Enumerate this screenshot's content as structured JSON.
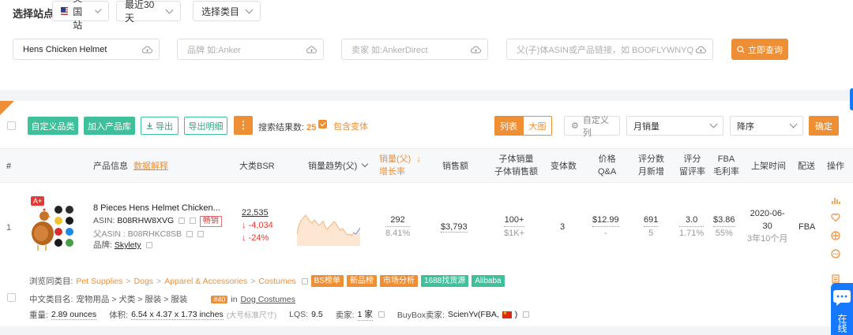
{
  "filters": {
    "site_label": "选择站点",
    "site": "美国站",
    "period": "最近30天",
    "category": "选择类目",
    "keyword_value": "Hens Chicken Helmet",
    "brand_placeholder": "品牌 如:Anker",
    "seller_placeholder": "卖家 如:AnkerDirect",
    "asin_placeholder": "父(子)体ASIN或产品链接，如 BOOFLYWNYQ",
    "query_button": "立即查询"
  },
  "toolbar": {
    "custom_category": "自定义品类",
    "add_library": "加入产品库",
    "export": "导出",
    "export_detail": "导出明细",
    "result_label": "搜索结果数:",
    "result_count": "25",
    "include_variants": "包含变体",
    "view_list": "列表",
    "view_grid": "大图",
    "custom_columns": "自定义列",
    "sort_field": "月销量",
    "sort_order": "降序",
    "confirm": "确定"
  },
  "columns": {
    "index": "#",
    "product_info": "产品信息",
    "data_explain": "数据解释",
    "bsr": "大类BSR",
    "trend": "销量趋势(父)",
    "sales_line1": "销量(父)",
    "sales_line2": "增长率",
    "revenue": "销售额",
    "child_sales_line1": "子体销量",
    "child_sales_line2": "子体销售额",
    "variants": "变体数",
    "price_line1": "价格",
    "price_line2": "Q&A",
    "reviews_line1": "评分数",
    "reviews_line2": "月新增",
    "rating_line1": "评分",
    "rating_line2": "留评率",
    "fba_line1": "FBA",
    "fba_line2": "毛利率",
    "listed": "上架时间",
    "delivery": "配送",
    "actions": "操作"
  },
  "product": {
    "index": "1",
    "badge": "A+",
    "title": "8 Pieces Hens Helmet Chicken...",
    "asin_label": "ASIN:",
    "asin": "B08RHW8XVG",
    "hot_tag": "畅销",
    "parent_asin_label": "父ASIN :",
    "parent_asin": "B08RHKC8SB",
    "brand_label": "品牌:",
    "brand": "Skylety",
    "bsr": "22,535",
    "bsr_change": "-4,034",
    "bsr_change_pct": "-24%",
    "sales": "292",
    "growth": "8.41%",
    "revenue": "$3,793",
    "child_sales": "100+",
    "child_revenue": "$1K+",
    "variants": "3",
    "price": "$12.99",
    "qa": "-",
    "reviews": "691",
    "reviews_new": "5",
    "rating": "3.0",
    "review_rate": "1.71%",
    "fba_fee": "$3.86",
    "margin": "55%",
    "listed_date_line1": "2020-06-",
    "listed_date_line2": "30",
    "listed_age": "3年10个月",
    "delivery": "FBA"
  },
  "details": {
    "browse_label": "浏览同类目:",
    "crumbs": [
      "Pet Supplies",
      "Dogs",
      "Apparel & Accessories",
      "Costumes"
    ],
    "tags": [
      "BS榜单",
      "新品榜",
      "市场分析",
      "1688找货源",
      "Alibaba"
    ],
    "cn_category_label": "中文类目名:",
    "cn_category": "宠物用品 > 犬类 > 服装 > 服装",
    "rank_badge": "#40",
    "rank_in": "in",
    "rank_category": "Dog Costumes",
    "weight_label": "重量:",
    "weight": "2.89 ounces",
    "volume_label": "体积:",
    "volume": "6.54 x 4.37 x 1.73 inches",
    "volume_note": "(大号标准尺寸)",
    "lqs_label": "LQS:",
    "lqs": "9.5",
    "seller_label": "卖家:",
    "seller_count": "1 家",
    "buybox_label": "BuyBox卖家:",
    "buybox": "ScienYv(FBA,"
  },
  "chat": {
    "label": "在线"
  },
  "chart_data": {
    "type": "area",
    "title": "",
    "x": [
      1,
      2,
      3,
      4,
      5,
      6,
      7,
      8,
      9,
      10,
      11,
      12,
      13,
      14,
      15,
      16,
      17,
      18,
      19,
      20,
      21,
      22,
      23,
      24,
      25,
      26,
      27,
      28,
      29,
      30
    ],
    "values": [
      30,
      55,
      65,
      72,
      78,
      70,
      62,
      58,
      66,
      60,
      52,
      56,
      63,
      48,
      42,
      50,
      55,
      62,
      56,
      46,
      40,
      44,
      36,
      28,
      30,
      26,
      34,
      30,
      38,
      46
    ],
    "ylim": [
      0,
      100
    ]
  },
  "colors": {
    "accent": "#ee8f35",
    "green": "#3fbf9a",
    "red": "#e53935",
    "chat_blue": "#1677ff"
  }
}
